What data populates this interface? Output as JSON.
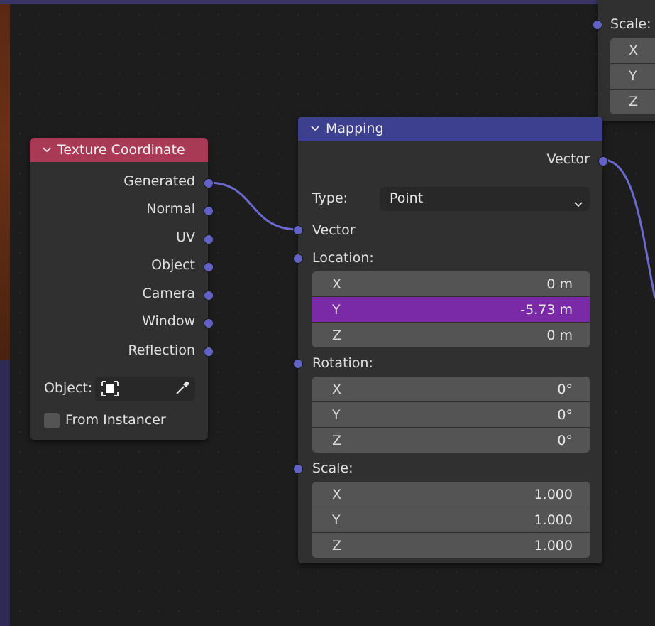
{
  "texture_coordinate_node": {
    "title": "Texture Coordinate",
    "header_color": "#a83a55",
    "outputs": [
      "Generated",
      "Normal",
      "UV",
      "Object",
      "Camera",
      "Window",
      "Reflection"
    ],
    "object_label": "Object:",
    "from_instancer_label": "From Instancer",
    "from_instancer_checked": false
  },
  "mapping_node": {
    "title": "Mapping",
    "header_color": "#3d3f8f",
    "output_vector_label": "Vector",
    "type_label": "Type:",
    "type_value": "Point",
    "input_vector_label": "Vector",
    "location": {
      "label": "Location:",
      "rows": [
        {
          "axis": "X",
          "value": "0 m"
        },
        {
          "axis": "Y",
          "value": "-5.73 m"
        },
        {
          "axis": "Z",
          "value": "0 m"
        }
      ],
      "active_row": "Y"
    },
    "rotation": {
      "label": "Rotation:",
      "rows": [
        {
          "axis": "X",
          "value": "0°"
        },
        {
          "axis": "Y",
          "value": "0°"
        },
        {
          "axis": "Z",
          "value": "0°"
        }
      ]
    },
    "scale": {
      "label": "Scale:",
      "rows": [
        {
          "axis": "X",
          "value": "1.000"
        },
        {
          "axis": "Y",
          "value": "1.000"
        },
        {
          "axis": "Z",
          "value": "1.000"
        }
      ]
    }
  },
  "partial_node": {
    "scale_label": "Scale:",
    "rows": [
      "X",
      "Y",
      "Z"
    ]
  },
  "colors": {
    "socket_vector": "#6363c7",
    "link": "#6a6ad0",
    "active_field": "#7a2aa6"
  }
}
